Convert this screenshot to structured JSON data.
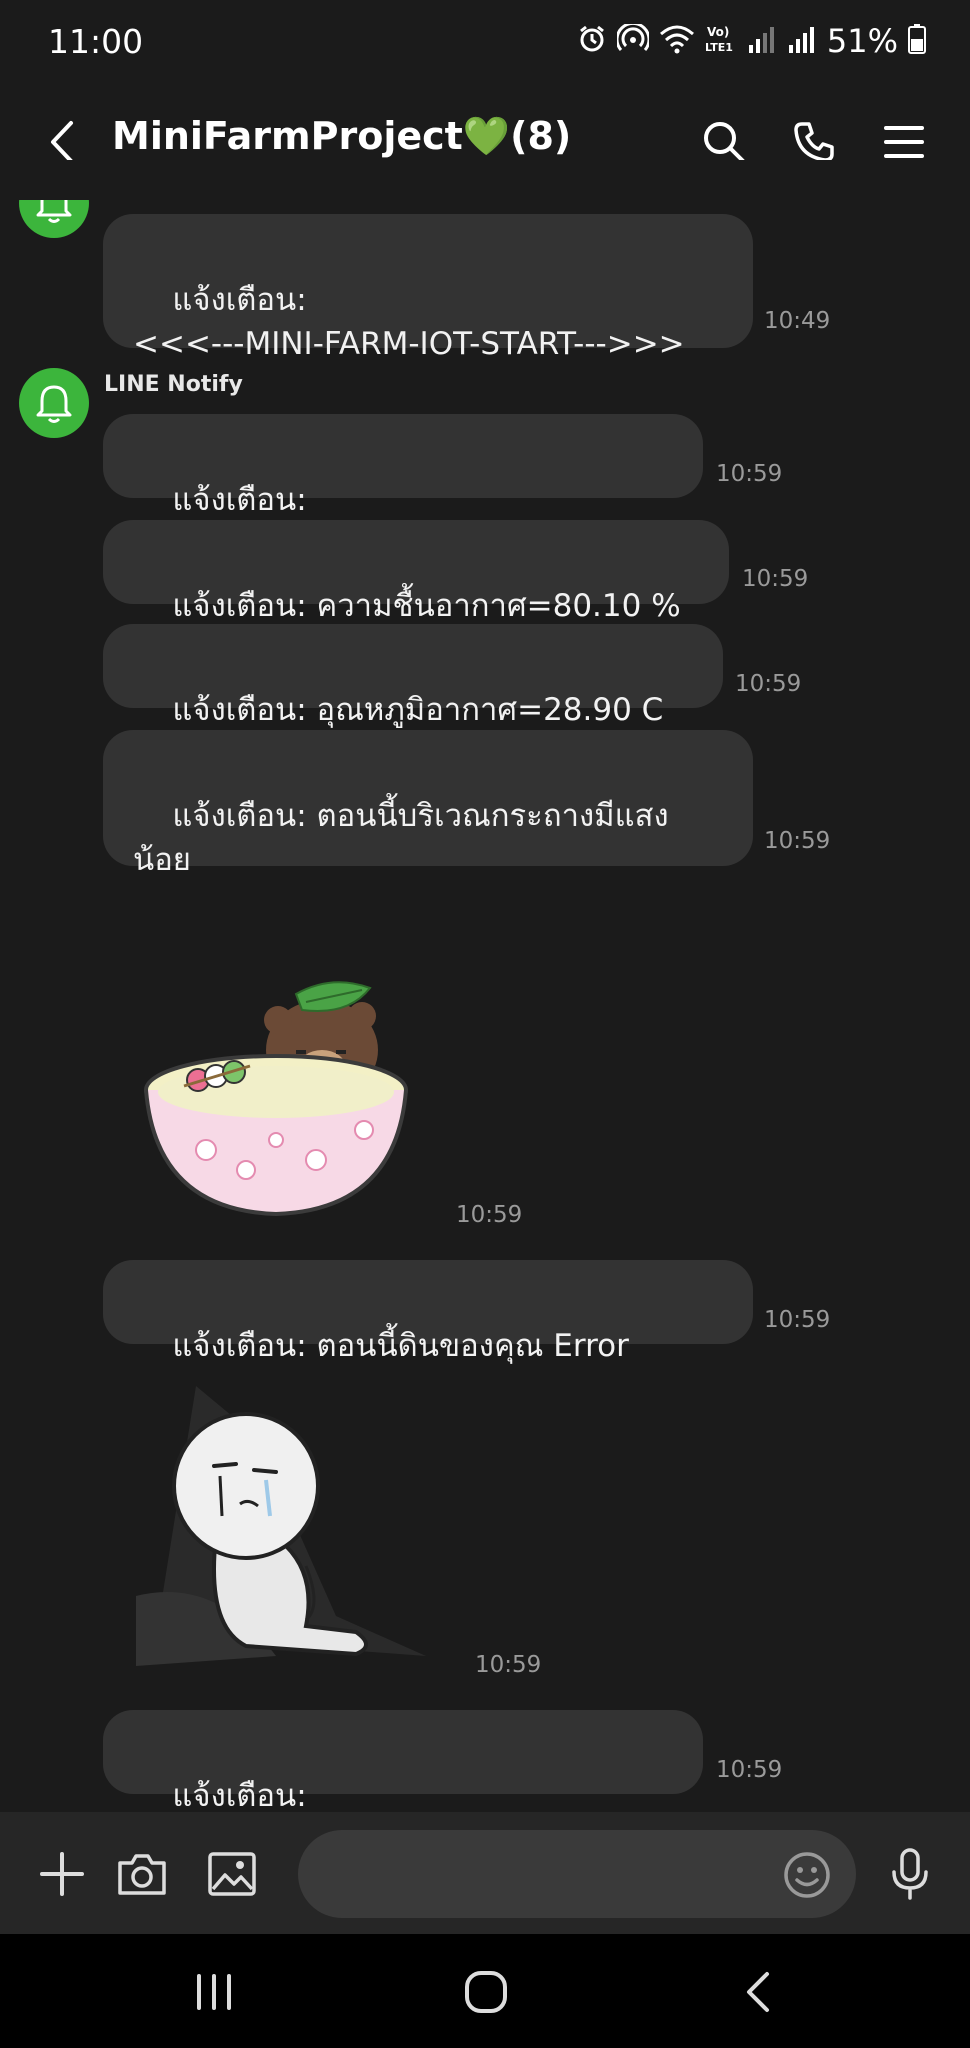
{
  "status_bar": {
    "time": "11:00",
    "battery_percent": "51%",
    "icons": [
      "alarm-icon",
      "hotspot-icon",
      "wifi-icon",
      "volte-icon",
      "signal-icon",
      "signal-icon",
      "battery-icon"
    ]
  },
  "header": {
    "title": "MiniFarmProject💚(8)",
    "icons": [
      "back-arrow-icon",
      "search-icon",
      "phone-icon",
      "menu-icon"
    ]
  },
  "messages": [
    {
      "text": "แจ้งเตือน:\n<<<---MINI-FARM-IOT-START--->>>",
      "time": "10:49"
    },
    {
      "sender": "LINE Notify",
      "text": "แจ้งเตือน: >>>>>>>>>>>>>>>>>>>>",
      "time": "10:59"
    },
    {
      "text": "แจ้งเตือน: ความชื้นอากาศ=80.10 %",
      "time": "10:59"
    },
    {
      "text": "แจ้งเตือน: อุณหภูมิอากาศ=28.90 C",
      "time": "10:59"
    },
    {
      "text": "แจ้งเตือน: ตอนนี้บริเวณกระถางมีแสง\nน้อย",
      "time": "10:59"
    },
    {
      "type": "sticker",
      "sticker": "bear-in-bowl-sticker",
      "time": "10:59"
    },
    {
      "text": "แจ้งเตือน: ตอนนี้ดินของคุณ Error",
      "time": "10:59"
    },
    {
      "type": "sticker",
      "sticker": "crying-character-sticker",
      "time": "10:59"
    },
    {
      "text": "แจ้งเตือน: >>>>>>>>>>>>>>>>>>>>",
      "time": "10:59"
    }
  ],
  "input_bar": {
    "icons": [
      "plus-icon",
      "camera-icon",
      "image-icon",
      "emoji-icon",
      "microphone-icon"
    ],
    "value": ""
  },
  "nav_bar": {
    "icons": [
      "recent-apps-icon",
      "home-icon",
      "back-icon"
    ]
  },
  "colors": {
    "background": "#1b1b1b",
    "bubble": "#333333",
    "avatar": "#3cb53c",
    "timestamp": "#9a9a9a"
  }
}
